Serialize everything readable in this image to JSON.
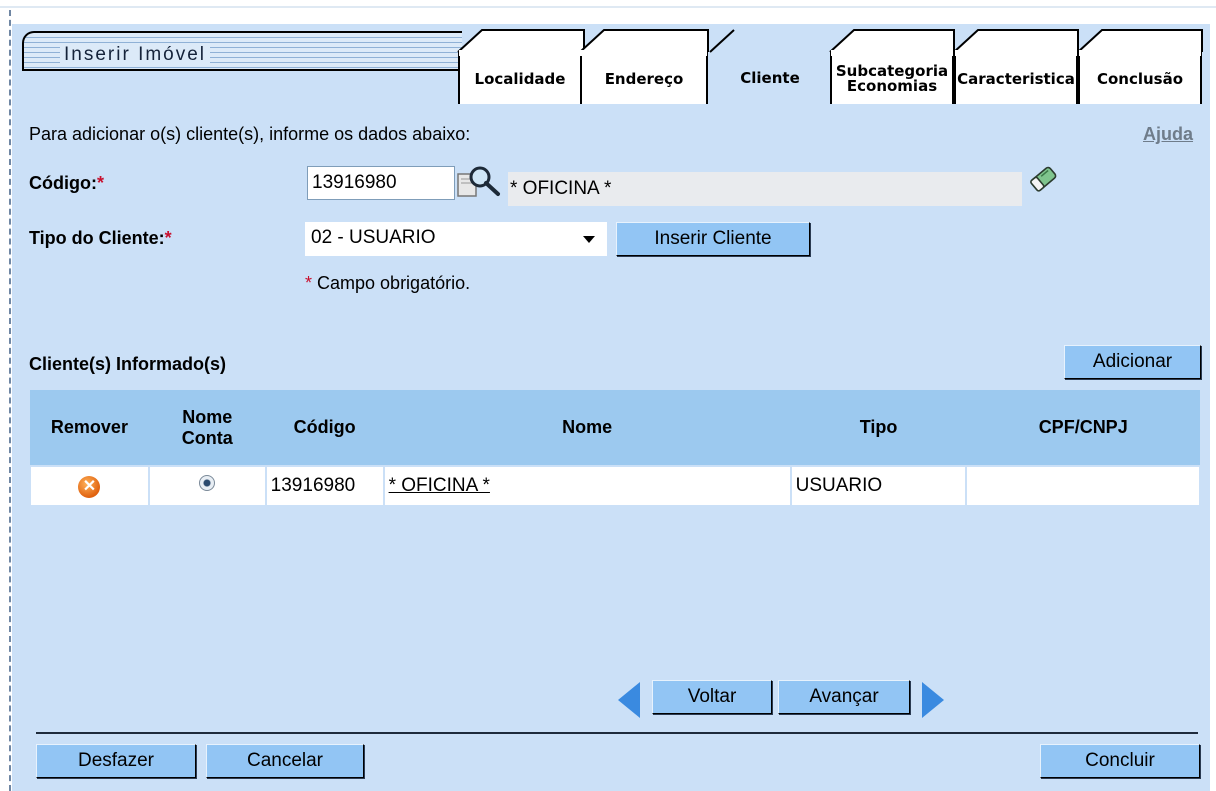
{
  "title": "Inserir Imóvel",
  "tabs": [
    {
      "label": "Localidade"
    },
    {
      "label": "Endereço"
    },
    {
      "label": "Cliente"
    },
    {
      "label_line1": "Subcategoria",
      "label_line2": "Economias"
    },
    {
      "label": "Caracteristica"
    },
    {
      "label": "Conclusão"
    }
  ],
  "instructions": "Para adicionar o(s) cliente(s), informe os dados abaixo:",
  "help_link": "Ajuda",
  "form": {
    "codigo_label": "Código:",
    "required_mark": "*",
    "codigo_value": "13916980",
    "cliente_nome": "* OFICINA *",
    "tipo_label": "Tipo do Cliente:",
    "tipo_selected": "02 - USUARIO",
    "inserir_button": "Inserir Cliente",
    "required_note_mark": "*",
    "required_note": " Campo obrigatório."
  },
  "list": {
    "title": "Cliente(s) Informado(s)",
    "add_button": "Adicionar",
    "headers": {
      "remover": "Remover",
      "nome_conta_1": "Nome",
      "nome_conta_2": "Conta",
      "codigo": "Código",
      "nome": "Nome",
      "tipo": "Tipo",
      "cpf": "CPF/CNPJ"
    },
    "rows": [
      {
        "codigo": "13916980",
        "nome": "* OFICINA *",
        "tipo": "USUARIO",
        "cpf": ""
      }
    ]
  },
  "nav": {
    "back": "Voltar",
    "next": "Avançar"
  },
  "footer": {
    "undo": "Desfazer",
    "cancel": "Cancelar",
    "finish": "Concluir"
  },
  "colors": {
    "panel": "#cbe0f7",
    "button": "#92c5f4",
    "table_header": "#9cc9ef",
    "required": "#c8102e"
  },
  "icons": [
    "search-magnifier-icon",
    "eraser-icon",
    "remove-x-icon",
    "radio-selected-icon",
    "arrow-left-icon",
    "arrow-right-icon"
  ]
}
